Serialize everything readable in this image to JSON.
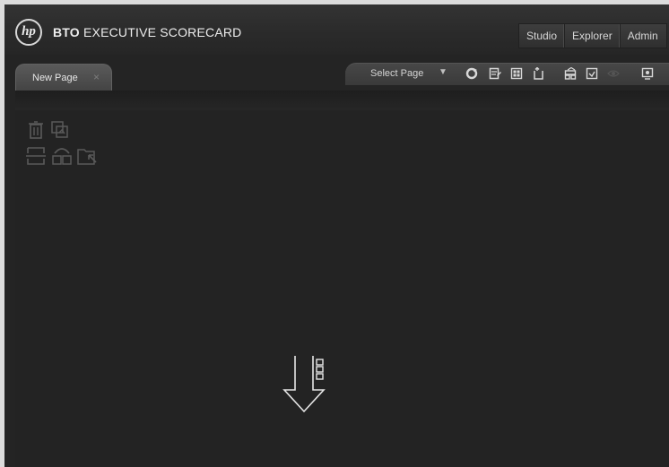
{
  "app": {
    "logo_text": "hp",
    "title_bold": "BTO",
    "title_rest": " EXECUTIVE SCORECARD"
  },
  "topnav": {
    "items": [
      "Studio",
      "Explorer",
      "Admin"
    ]
  },
  "tabs": [
    {
      "label": "New Page",
      "close": "×"
    }
  ],
  "toolbar": {
    "select_page_label": "Select Page",
    "select_caret": "▼",
    "icons": [
      "refresh-icon",
      "save-page-icon",
      "layout-icon",
      "new-page-icon",
      "properties-icon",
      "export-icon",
      "eye-icon",
      "preview-icon"
    ]
  },
  "side_tools": [
    "delete-icon",
    "image-icon",
    "split-horizontal-icon",
    "layout-icon",
    "move-icon"
  ],
  "colors": {
    "background": "#242424",
    "accent": "#e6e6e6"
  }
}
